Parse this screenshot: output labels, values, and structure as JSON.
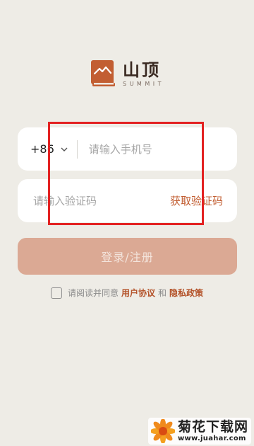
{
  "brand": {
    "name": "山顶",
    "subtitle": "SUMMIT",
    "icon": "mountain-book-icon",
    "color": "#c25e32"
  },
  "phone": {
    "country_code": "+86",
    "placeholder": "请输入手机号"
  },
  "code": {
    "placeholder": "请输入验证码",
    "get_code_label": "获取验证码"
  },
  "login_button": {
    "label": "登录/注册"
  },
  "agreement": {
    "prefix": "请阅读并同意",
    "terms": "用户协议",
    "and": "和",
    "privacy": "隐私政策"
  },
  "watermark": {
    "name": "菊花下载网",
    "url": "www.juahar.com"
  }
}
